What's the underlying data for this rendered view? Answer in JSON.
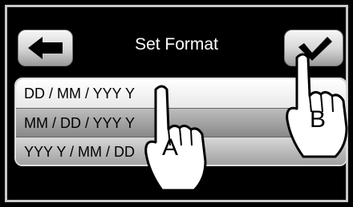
{
  "header": {
    "title": "Set Format",
    "back_icon": "arrow-left-icon",
    "confirm_icon": "checkmark-icon"
  },
  "format_options": [
    {
      "label": "DD / MM / YYY Y",
      "state": "highlighted"
    },
    {
      "label": "MM / DD / YYY Y",
      "state": "normal"
    },
    {
      "label": "YYY Y / MM / DD",
      "state": "normal"
    }
  ],
  "callouts": {
    "a": "A",
    "b": "B"
  },
  "colors": {
    "background": "#000000",
    "frame": "#c8c8c8",
    "title_text": "#ffffff"
  }
}
